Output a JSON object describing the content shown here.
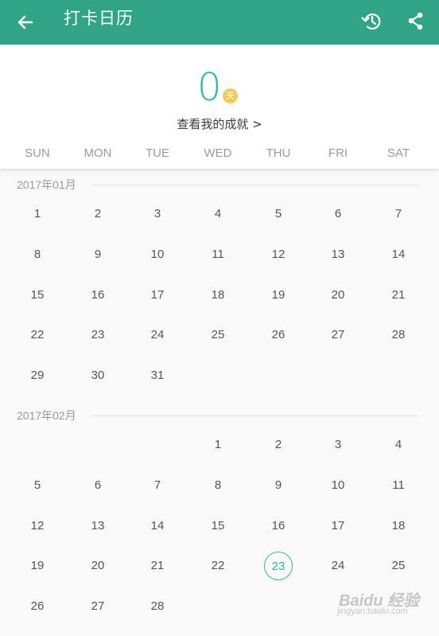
{
  "appbar": {
    "title": "打卡日历",
    "back_icon": "arrow-left-icon",
    "history_icon": "history-icon",
    "share_icon": "share-icon",
    "color": "#2fa586"
  },
  "summary": {
    "count": "0",
    "unit": "天",
    "achievement_link": "查看我的成就 >"
  },
  "weekdays": [
    "SUN",
    "MON",
    "TUE",
    "WED",
    "THU",
    "FRI",
    "SAT"
  ],
  "months": [
    {
      "label": "2017年01月",
      "weeks": [
        [
          "1",
          "2",
          "3",
          "4",
          "5",
          "6",
          "7"
        ],
        [
          "8",
          "9",
          "10",
          "11",
          "12",
          "13",
          "14"
        ],
        [
          "15",
          "16",
          "17",
          "18",
          "19",
          "20",
          "21"
        ],
        [
          "22",
          "23",
          "24",
          "25",
          "26",
          "27",
          "28"
        ],
        [
          "29",
          "30",
          "31",
          "",
          "",
          "",
          ""
        ]
      ]
    },
    {
      "label": "2017年02月",
      "weeks": [
        [
          "",
          "",
          "",
          "1",
          "2",
          "3",
          "4"
        ],
        [
          "5",
          "6",
          "7",
          "8",
          "9",
          "10",
          "11"
        ],
        [
          "12",
          "13",
          "14",
          "15",
          "16",
          "17",
          "18"
        ],
        [
          "19",
          "20",
          "21",
          "22",
          "23",
          "24",
          "25"
        ],
        [
          "26",
          "27",
          "28",
          "",
          "",
          "",
          ""
        ]
      ]
    }
  ],
  "today": {
    "month": "2017年02月",
    "day": "23"
  },
  "accent_color": "#2fc08e",
  "watermark": {
    "top": "Baidu 经验",
    "bottom": "jingyan.baidu.com"
  }
}
